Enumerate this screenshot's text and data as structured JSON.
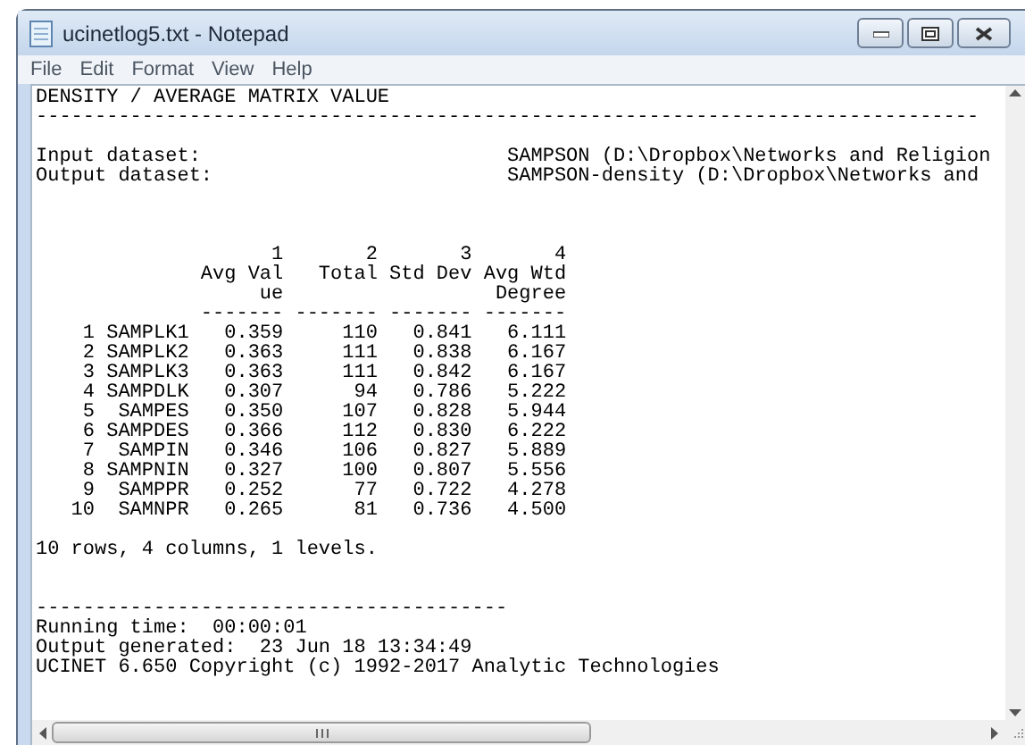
{
  "window": {
    "title": "ucinetlog5.txt - Notepad"
  },
  "menu": [
    "File",
    "Edit",
    "Format",
    "View",
    "Help"
  ],
  "document": {
    "blocks": [
      {
        "kind": "heading",
        "lines": [
          "DENSITY / AVERAGE MATRIX VALUE",
          "--------------------------------------------------------------------------------"
        ]
      },
      {
        "kind": "datasets",
        "lines": [
          "Input dataset:                          SAMPSON (D:\\Dropbox\\Networks and Religion",
          "Output dataset:                         SAMPSON-density (D:\\Dropbox\\Networks and"
        ]
      },
      {
        "kind": "table",
        "lines": [
          "                    1       2       3       4",
          "              Avg Val   Total Std Dev Avg Wtd",
          "                   ue                  Degree",
          "              ------- ------- ------- -------",
          "    1 SAMPLK1   0.359     110   0.841   6.111",
          "    2 SAMPLK2   0.363     111   0.838   6.167",
          "    3 SAMPLK3   0.363     111   0.842   6.167",
          "    4 SAMPDLK   0.307      94   0.786   5.222",
          "    5  SAMPES   0.350     107   0.828   5.944",
          "    6 SAMPDES   0.366     112   0.830   6.222",
          "    7  SAMPIN   0.346     106   0.827   5.889",
          "    8 SAMPNIN   0.327     100   0.807   5.556",
          "    9  SAMPPR   0.252      77   0.722   4.278",
          "   10  SAMNPR   0.265      81   0.736   4.500"
        ]
      },
      {
        "kind": "summary",
        "lines": [
          "10 rows, 4 columns, 1 levels."
        ]
      },
      {
        "kind": "footer",
        "lines": [
          "----------------------------------------",
          "Running time:  00:00:01",
          "Output generated:  23 Jun 18 13:34:49",
          "UCINET 6.650 Copyright (c) 1992-2017 Analytic Technologies"
        ]
      }
    ]
  }
}
